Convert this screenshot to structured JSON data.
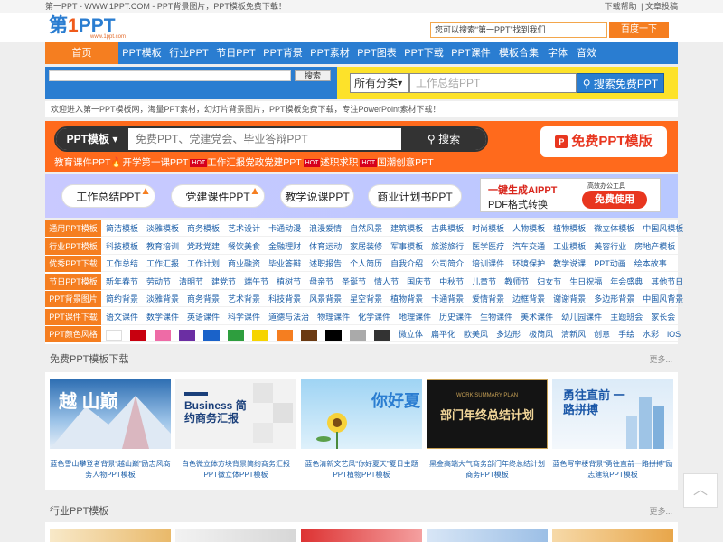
{
  "topbar": {
    "left": "第一PPT - WWW.1PPT.COM - PPT背景图片，PPT模板免费下载！",
    "help": "下载帮助",
    "sep": "|",
    "submit": "文章投稿"
  },
  "logo": {
    "main_a": "第",
    "main_one": "1",
    "main_b": "PPT",
    "sub": "www.1ppt.com"
  },
  "header_search": {
    "placeholder": "您可以搜索“第一PPT”找到我们",
    "button": "百度一下"
  },
  "nav": {
    "items": [
      "首页",
      "PPT模板",
      "行业PPT",
      "节日PPT",
      "PPT背景",
      "PPT素材",
      "PPT图表",
      "PPT下载",
      "PPT课件",
      "模板合集",
      "字体",
      "音效"
    ]
  },
  "search_row": {
    "site_button": "搜索",
    "category": "所有分类",
    "placeholder": "工作总结PPT",
    "free_search": "搜索免费PPT"
  },
  "welcome": "欢迎进入第一PPT模板网，海量PPT素材，幻灯片背景图片，PPT模板免费下载，专注PowerPoint素材下载！",
  "banner": {
    "category": "PPT模板",
    "placeholder": "免费PPT、党建党会、毕业答辩PPT",
    "search": "搜索",
    "free_label": "免费PPT模版",
    "hot": [
      {
        "text": "教育课件PPT",
        "mark": "🔥"
      },
      {
        "text": "开学第一课PPT",
        "tag": "HOT"
      },
      {
        "text": "工作汇报"
      },
      {
        "text": "党政党建PPT",
        "tag": "HOT"
      },
      {
        "text": "述职求职",
        "tag": "HOT"
      },
      {
        "text": "国潮创意PPT"
      }
    ]
  },
  "cards": {
    "pills": [
      "工作总结PPT",
      "党建课件PPT",
      "教学说课PPT",
      "商业计划书PPT"
    ],
    "ai": {
      "line1": "一键生成AIPPT",
      "line2": "PDF格式转换",
      "note": "高效办公工具",
      "button": "免费使用"
    }
  },
  "categories": [
    {
      "label": "通用PPT模板",
      "links": [
        "简洁模板",
        "淡雅模板",
        "商务模板",
        "艺术设计",
        "卡通动漫",
        "浪漫爱情",
        "自然风景",
        "建筑模板",
        "古典模板",
        "时尚模板",
        "人物模板",
        "植物模板",
        "微立体模板",
        "中国风模板"
      ]
    },
    {
      "label": "行业PPT模板",
      "links": [
        "科技模板",
        "教育培训",
        "党政党建",
        "餐饮美食",
        "金融理财",
        "体育运动",
        "家居装修",
        "军事模板",
        "旅游旅行",
        "医学医疗",
        "汽车交通",
        "工业模板",
        "美容行业",
        "房地产模板"
      ]
    },
    {
      "label": "优秀PPT下载",
      "links": [
        "工作总结",
        "工作汇报",
        "工作计划",
        "商业融资",
        "毕业答辩",
        "述职报告",
        "个人简历",
        "自我介绍",
        "公司简介",
        "培训课件",
        "环境保护",
        "教学说课",
        "PPT动画",
        "绘本故事"
      ]
    },
    {
      "label": "节日PPT模板",
      "links": [
        "新年春节",
        "劳动节",
        "清明节",
        "建党节",
        "端午节",
        "植树节",
        "母亲节",
        "圣诞节",
        "情人节",
        "国庆节",
        "中秋节",
        "儿童节",
        "教师节",
        "妇女节",
        "生日祝福",
        "年会盛典",
        "其他节日"
      ]
    },
    {
      "label": "PPT背景图片",
      "links": [
        "简约背景",
        "淡雅背景",
        "商务背景",
        "艺术背景",
        "科技背景",
        "风景背景",
        "星空背景",
        "植物背景",
        "卡通背景",
        "爱情背景",
        "边框背景",
        "谢谢背景",
        "多边形背景",
        "中国风背景"
      ]
    },
    {
      "label": "PPT课件下载",
      "links": [
        "语文课件",
        "数学课件",
        "英语课件",
        "科学课件",
        "道德与法治",
        "物理课件",
        "化学课件",
        "地理课件",
        "历史课件",
        "生物课件",
        "美术课件",
        "幼儿园课件",
        "主题班会",
        "家长会"
      ]
    },
    {
      "label": "PPT颜色风格",
      "colors": [
        "#ffffff",
        "#c8000f",
        "#ee6ba6",
        "#6b2ea3",
        "#1a62c9",
        "#2e9e3e",
        "#f6d400",
        "#f57e20",
        "#6b3a12",
        "#000000",
        "#aaaaaa",
        "#333333"
      ],
      "links": [
        "微立体",
        "扁平化",
        "欧美风",
        "多边形",
        "极简风",
        "清新风",
        "创意",
        "手绘",
        "水彩",
        "iOS"
      ]
    }
  ],
  "section_free": {
    "title": "免费PPT模板下载",
    "more": "更多..."
  },
  "items": [
    {
      "caption": "蓝色雪山攀登者背景“越山巅”励志风商务人物PPT模板",
      "thumb_text": "越 山巅"
    },
    {
      "caption": "白色微立体方块背景简约商务汇报PPT微立体PPT模板",
      "thumb_text": "Business 简约商务汇报"
    },
    {
      "caption": "蓝色清新文艺风“你好夏天”夏日主题PPT植物PPT模板",
      "thumb_text": "你好夏"
    },
    {
      "caption": "黑金高端大气商务部门年终总结计划商务PPT模板",
      "thumb_text": "部门年终总结计划",
      "thumb_sub": "WORK SUMMARY PLAN"
    },
    {
      "caption": "蓝色写字楼背景“勇往直前一路拼搏”励志建筑PPT模板",
      "thumb_text": "勇往直前 一路拼搏"
    }
  ],
  "section_industry": {
    "title": "行业PPT模板",
    "more": "更多..."
  },
  "back_to_top": "︿"
}
